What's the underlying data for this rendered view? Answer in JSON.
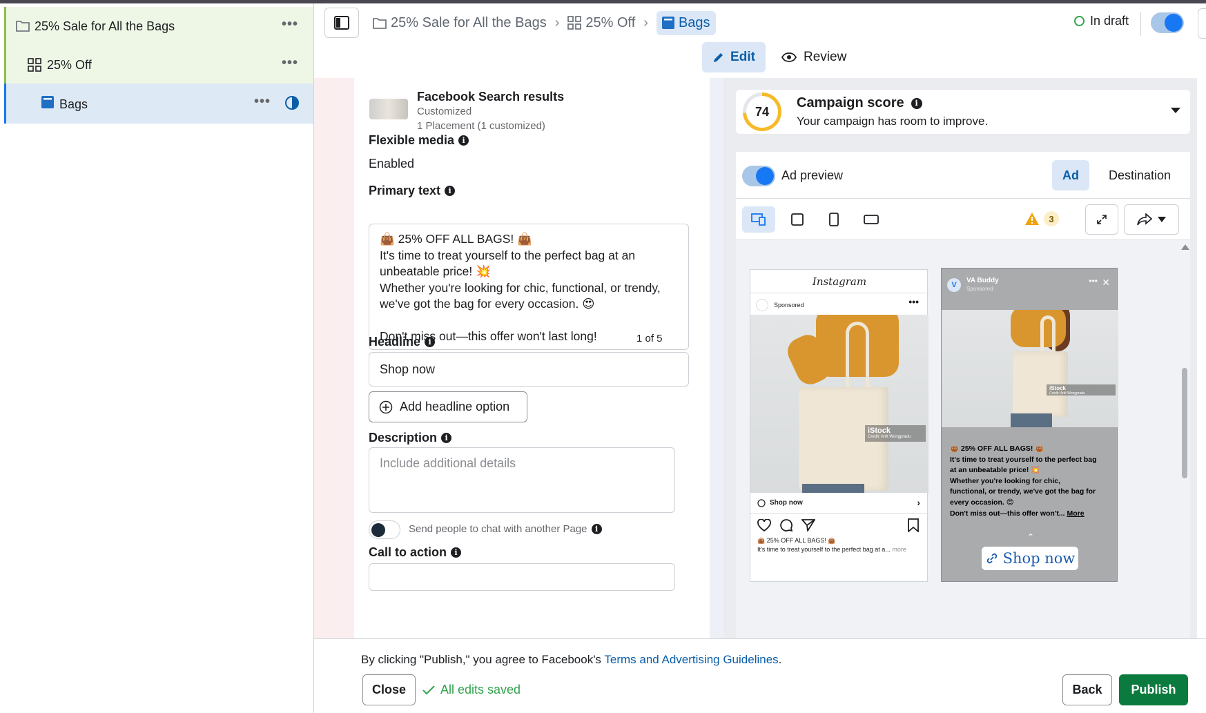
{
  "tree": {
    "items": [
      {
        "label": "25% Sale for All the Bags",
        "icon": "folder-icon"
      },
      {
        "label": "25% Off",
        "icon": "grid-icon"
      },
      {
        "label": "Bags",
        "icon": "ad-icon"
      }
    ]
  },
  "breadcrumbs": [
    "25% Sale for All the Bags",
    "25% Off",
    "Bags"
  ],
  "status": {
    "label": "In draft",
    "color": "#31a24c"
  },
  "mode_tabs": {
    "edit": "Edit",
    "review": "Review"
  },
  "placement": {
    "title": "Facebook Search results",
    "status": "Customized",
    "count": "1 Placement (1 customized)"
  },
  "flexible_media": {
    "label": "Flexible media",
    "value": "Enabled"
  },
  "primary_text": {
    "label": "Primary text",
    "lines": [
      "👜 25% OFF ALL BAGS! 👜",
      "It's time to treat yourself to the perfect bag at an",
      "unbeatable price! 💥",
      "Whether you're looking for chic, functional, or trendy,",
      "we've got the bag for every occasion. 😍",
      "",
      "Don't miss out—this offer won't last long!"
    ]
  },
  "headline": {
    "label": "Headline",
    "counter": "1 of 5",
    "value": "Shop now",
    "add_label": "Add headline option"
  },
  "description": {
    "label": "Description",
    "placeholder": "Include additional details"
  },
  "chat": {
    "label": "Send people to chat with another Page"
  },
  "cta": {
    "label": "Call to action"
  },
  "campaign_score": {
    "score": "74",
    "title": "Campaign score",
    "subtitle": "Your campaign has room to improve."
  },
  "preview": {
    "toggle_label": "Ad preview",
    "tab_ad": "Ad",
    "tab_destination": "Destination",
    "warning_count": "3",
    "instagram": {
      "logo": "Instagram",
      "sponsored": "Sponsored",
      "cta": "Shop now",
      "caption1": "👜 25% OFF ALL BAGS! 👜",
      "caption2": "It's time to treat yourself to the perfect bag at a...",
      "more": "more",
      "watermark": "iStock",
      "credit": "Credit: Artit Wongpradu"
    },
    "story": {
      "avatar": "V",
      "name": "VA Buddy",
      "sponsored": "Sponsored",
      "text_lines": [
        "👜 25% OFF ALL BAGS! 👜",
        "It's time to treat yourself to the perfect bag",
        "at an unbeatable price! 💥",
        "Whether you're looking for chic,",
        "functional, or trendy, we've got the bag for",
        "every occasion. 😍",
        "Don't miss out—this offer won't..."
      ],
      "more": "More",
      "cta": "Shop now",
      "watermark": "iStock",
      "credit": "Credit: Artit Wongpradu"
    }
  },
  "footer": {
    "terms_prefix": "By clicking \"Publish,\" you agree to Facebook's ",
    "terms_link": "Terms and Advertising Guidelines",
    "terms_suffix": ".",
    "close": "Close",
    "saved": "All edits saved",
    "back": "Back",
    "publish": "Publish"
  }
}
